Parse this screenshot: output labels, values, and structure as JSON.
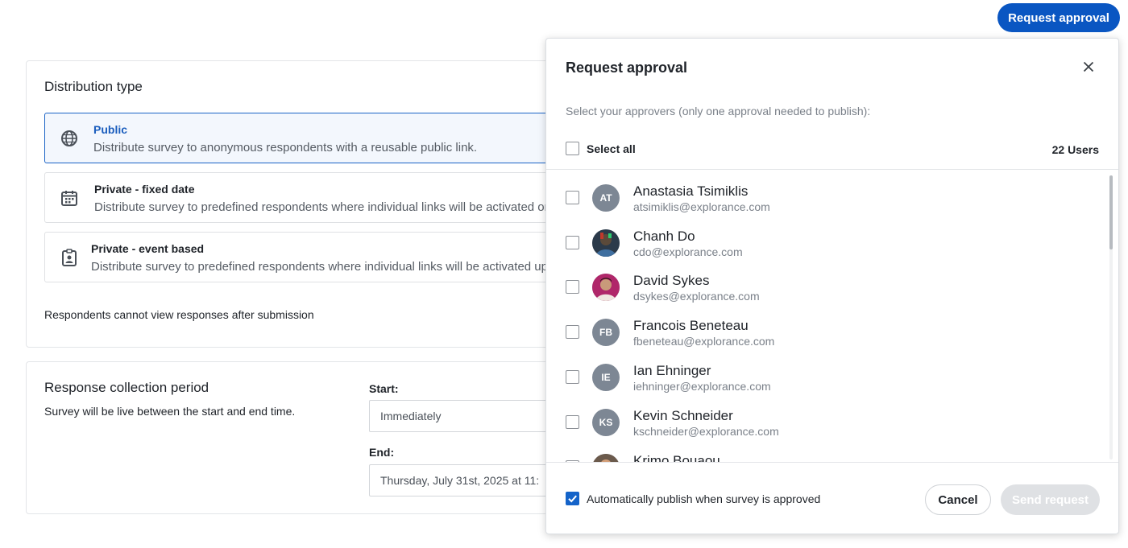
{
  "header": {
    "request_approval_button": "Request approval"
  },
  "distribution": {
    "title": "Distribution type",
    "options": [
      {
        "title": "Public",
        "description": "Distribute survey to anonymous respondents with a reusable public link.",
        "icon": "globe-icon",
        "selected": true
      },
      {
        "title": "Private - fixed date",
        "description": "Distribute survey to predefined respondents where individual links will be activated on a",
        "icon": "calendar-icon",
        "selected": false
      },
      {
        "title": "Private - event based",
        "description": "Distribute survey to predefined respondents where individual links will be activated upo",
        "icon": "clipboard-user-icon",
        "selected": false
      }
    ],
    "note": "Respondents cannot view responses after submission"
  },
  "period": {
    "title": "Response collection period",
    "subtitle": "Survey will be live between the start and end time.",
    "start_label": "Start:",
    "start_value": "Immediately",
    "end_label": "End:",
    "end_value": "Thursday, July 31st, 2025 at 11:"
  },
  "modal": {
    "title": "Request approval",
    "subtitle": "Select your approvers (only one approval needed to publish):",
    "select_all_label": "Select all",
    "users_count": "22 Users",
    "users": [
      {
        "initials": "AT",
        "name": "Anastasia Tsimiklis",
        "email": "atsimiklis@explorance.com",
        "photo": false
      },
      {
        "initials": "",
        "name": "Chanh Do",
        "email": "cdo@explorance.com",
        "photo": true
      },
      {
        "initials": "",
        "name": "David Sykes",
        "email": "dsykes@explorance.com",
        "photo": true
      },
      {
        "initials": "FB",
        "name": "Francois Beneteau",
        "email": "fbeneteau@explorance.com",
        "photo": false
      },
      {
        "initials": "IE",
        "name": "Ian Ehninger",
        "email": "iehninger@explorance.com",
        "photo": false
      },
      {
        "initials": "KS",
        "name": "Kevin Schneider",
        "email": "kschneider@explorance.com",
        "photo": false
      },
      {
        "initials": "",
        "name": "Krimo Bouaou",
        "email": "",
        "photo": true
      }
    ],
    "auto_publish_label": "Automatically publish when survey is approved",
    "auto_publish_checked": true,
    "cancel_label": "Cancel",
    "send_label": "Send request"
  },
  "colors": {
    "primary": "#0a56c2",
    "checkbox": "#1463c9",
    "avatar": "#7d8794",
    "disabled": "#dfe1e4"
  }
}
